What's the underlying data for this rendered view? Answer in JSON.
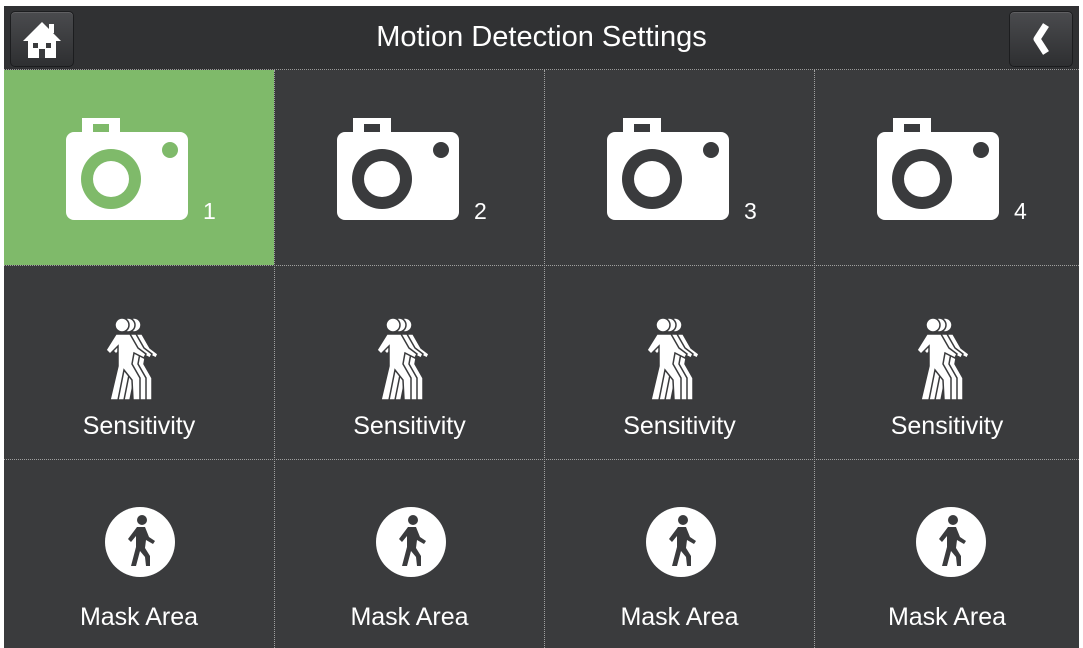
{
  "header": {
    "title": "Motion Detection Settings",
    "home_icon": "home-icon",
    "back_icon": "chevron-left-icon"
  },
  "colors": {
    "active_cell": "#7fba6a",
    "background": "#3a3b3d",
    "header": "#303133",
    "text": "#ffffff"
  },
  "cameras": [
    {
      "number": "1",
      "selected": true,
      "sensitivity_label": "Sensitivity",
      "mask_label": "Mask Area"
    },
    {
      "number": "2",
      "selected": false,
      "sensitivity_label": "Sensitivity",
      "mask_label": "Mask Area"
    },
    {
      "number": "3",
      "selected": false,
      "sensitivity_label": "Sensitivity",
      "mask_label": "Mask Area"
    },
    {
      "number": "4",
      "selected": false,
      "sensitivity_label": "Sensitivity",
      "mask_label": "Mask Area"
    }
  ]
}
